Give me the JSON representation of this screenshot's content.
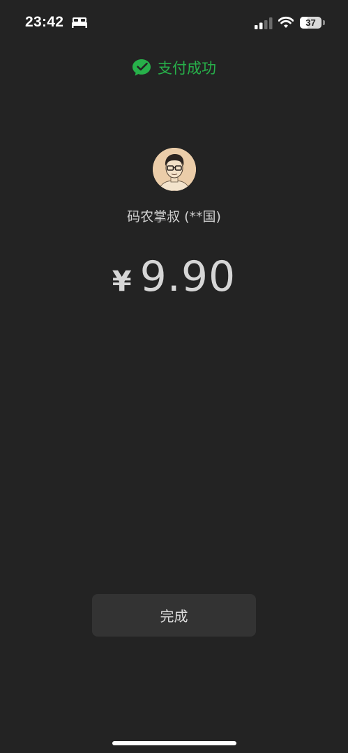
{
  "status_bar": {
    "time": "23:42",
    "battery": "37",
    "battery_fraction": 0.37,
    "icons": [
      "bed-icon",
      "signal-icon",
      "wifi-icon",
      "battery-icon"
    ]
  },
  "header": {
    "title": "支付成功",
    "icon": "wechat-pay-icon",
    "accent_color": "#27b04a"
  },
  "merchant": {
    "name": "码农掌叔 (**国)",
    "avatar": "avatar"
  },
  "payment": {
    "currency_symbol": "¥",
    "amount": "9.90"
  },
  "actions": {
    "done_label": "完成"
  },
  "theme": {
    "background": "#232323",
    "button_background": "#333333"
  }
}
